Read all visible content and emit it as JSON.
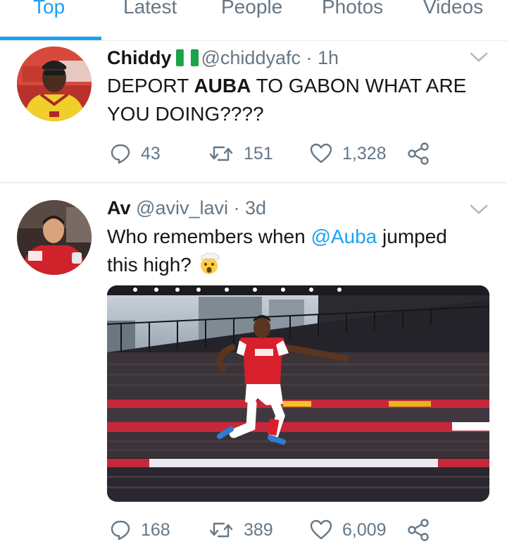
{
  "tabs": [
    {
      "label": "Top",
      "active": true
    },
    {
      "label": "Latest",
      "active": false
    },
    {
      "label": "People",
      "active": false
    },
    {
      "label": "Photos",
      "active": false
    },
    {
      "label": "Videos",
      "active": false
    }
  ],
  "tweets": [
    {
      "name": "Chiddy",
      "flag": "nigeria-flag-emoji",
      "handle": "@chiddyafc",
      "sep": " · ",
      "time": "1h",
      "text_1": "DEPORT ",
      "text_bold": "AUBA",
      "text_2": " TO GABON WHAT ARE",
      "text_3": "YOU DOING????",
      "replies": "43",
      "retweets": "151",
      "likes": "1,328"
    },
    {
      "name": "Av",
      "handle": "@aviv_lavi",
      "sep": " · ",
      "time": "3d",
      "text_1": "Who remembers when ",
      "mention": "@Auba",
      "text_2": " jumped",
      "text_3": "this high? ",
      "emoji": "exploding-head-emoji",
      "replies": "168",
      "retweets": "389",
      "likes": "6,009",
      "media": "photo-footballer-jumping-in-stadium"
    }
  ],
  "colors": {
    "accent": "#1da1f2",
    "secondary": "#657786",
    "text": "#14171a",
    "divider": "#e6ecf0"
  }
}
